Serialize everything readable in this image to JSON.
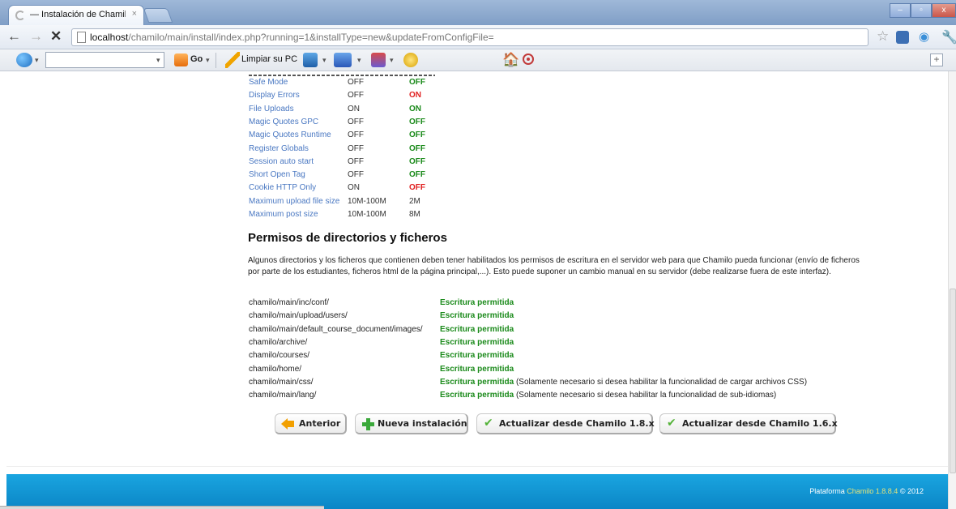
{
  "browser": {
    "tab_title": "— Instalación de Chamilo",
    "tab_close": "×",
    "url_prefix": "localhost",
    "url_path": "/chamilo/main/install/index.php?running=1&installType=new&updateFromConfigFile=",
    "nav_back": "←",
    "nav_forward": "→",
    "nav_stop": "✕",
    "bookmark_star": "☆",
    "window_min": "–",
    "window_max": "▫",
    "window_close": "x"
  },
  "toolbar": {
    "go_label": "Go",
    "clean_label": "Limpiar su PC",
    "caret": "▾",
    "plus": "+"
  },
  "php_params": [
    {
      "name": "Safe Mode",
      "recommended": "OFF",
      "current": "OFF",
      "status": "ok"
    },
    {
      "name": "Display Errors",
      "recommended": "OFF",
      "current": "ON",
      "status": "bad"
    },
    {
      "name": "File Uploads",
      "recommended": "ON",
      "current": "ON",
      "status": "ok"
    },
    {
      "name": "Magic Quotes GPC",
      "recommended": "OFF",
      "current": "OFF",
      "status": "ok"
    },
    {
      "name": "Magic Quotes Runtime",
      "recommended": "OFF",
      "current": "OFF",
      "status": "ok"
    },
    {
      "name": "Register Globals",
      "recommended": "OFF",
      "current": "OFF",
      "status": "ok"
    },
    {
      "name": "Session auto start",
      "recommended": "OFF",
      "current": "OFF",
      "status": "ok"
    },
    {
      "name": "Short Open Tag",
      "recommended": "OFF",
      "current": "OFF",
      "status": "ok"
    },
    {
      "name": "Cookie HTTP Only",
      "recommended": "ON",
      "current": "OFF",
      "status": "bad"
    },
    {
      "name": "Maximum upload file size",
      "recommended": "10M-100M",
      "current": "2M",
      "status": "plain"
    },
    {
      "name": "Maximum post size",
      "recommended": "10M-100M",
      "current": "8M",
      "status": "plain"
    }
  ],
  "permissions": {
    "title": "Permisos de directorios y ficheros",
    "description": "Algunos directorios y los ficheros que contienen deben tener habilitados los permisos de escritura en el servidor web para que Chamilo pueda funcionar (envío de ficheros por parte de los estudiantes, ficheros html de la página principal,...). Esto puede suponer un cambio manual en su servidor (debe realizarse fuera de este interfaz).",
    "rows": [
      {
        "path": "chamilo/main/inc/conf/",
        "status": "Escritura permitida",
        "note": ""
      },
      {
        "path": "chamilo/main/upload/users/",
        "status": "Escritura permitida",
        "note": ""
      },
      {
        "path": "chamilo/main/default_course_document/images/",
        "status": "Escritura permitida",
        "note": ""
      },
      {
        "path": "chamilo/archive/",
        "status": "Escritura permitida",
        "note": ""
      },
      {
        "path": "chamilo/courses/",
        "status": "Escritura permitida",
        "note": ""
      },
      {
        "path": "chamilo/home/",
        "status": "Escritura permitida",
        "note": ""
      },
      {
        "path": "chamilo/main/css/",
        "status": "Escritura permitida",
        "note": "(Solamente necesario si desea habilitar la funcionalidad de cargar archivos CSS)"
      },
      {
        "path": "chamilo/main/lang/",
        "status": "Escritura permitida",
        "note": "(Solamente necesario si desea habilitar la funcionalidad de sub-idiomas)"
      }
    ]
  },
  "buttons": {
    "previous": "Anterior",
    "new_install": "Nueva instalación",
    "update_18": "Actualizar desde Chamilo 1.8.x",
    "update_16": "Actualizar desde Chamilo 1.6.x",
    "check": "✔"
  },
  "footer": {
    "platform": "Plataforma",
    "brand": "Chamilo 1.8.8.4",
    "copyright": "© 2012"
  },
  "colors": {
    "ok": "#1a8a1a",
    "bad": "#e02020",
    "link": "#4a78c2",
    "footer": "#0b86c6"
  }
}
